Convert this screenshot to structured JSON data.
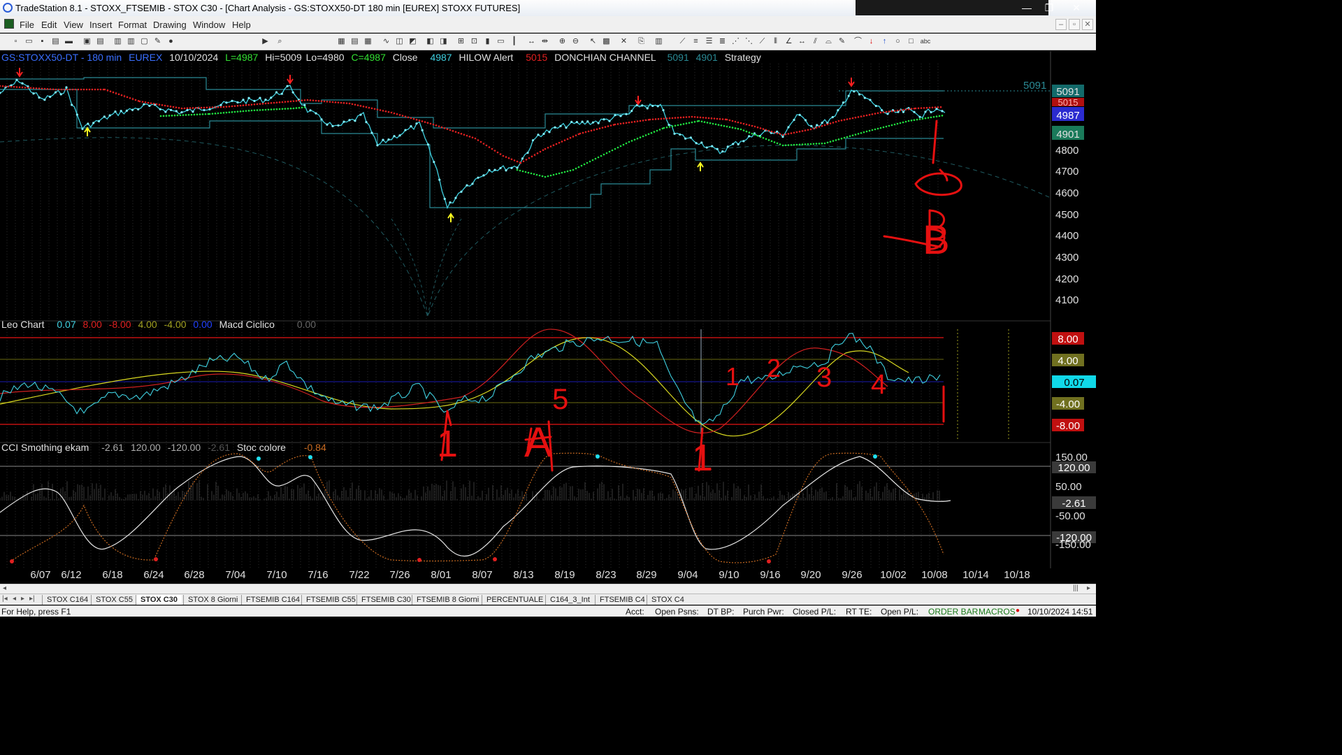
{
  "window": {
    "title": "TradeStation 8.1 - STOXX_FTSEMIB - STOX  C30 - [Chart Analysis - GS:STOXX50-DT  180 min  [EUREX] STOXX FUTURES]",
    "minimize": "—",
    "restore": "❐",
    "close": "✕"
  },
  "menu": {
    "items": [
      "File",
      "Edit",
      "View",
      "Insert",
      "Format",
      "Drawing",
      "Window",
      "Help"
    ],
    "mdi": [
      "–",
      "▫",
      "✕"
    ]
  },
  "toolbar": {
    "symbol_value": "r",
    "text_tool": "abc"
  },
  "price_panel": {
    "symbol": "GS:STOXX50-DT - 180 min",
    "exchange": "EUREX",
    "date": "10/10/2024",
    "last": "L=4987",
    "hi": "Hi=5009",
    "lo": "Lo=4980",
    "close_val": "C=4987",
    "close_lbl": "Close",
    "close_num": "4987",
    "hilow": "HILOW Alert",
    "hilow_num": "5015",
    "donchian": "DONCHIAN CHANNEL",
    "don_hi": "5091",
    "don_lo": "4901",
    "strategy": "Strategy",
    "level_5091_text": "5091",
    "axis_ticks": [
      "4800",
      "4700",
      "4600",
      "4500",
      "4400",
      "4300",
      "4200",
      "4100"
    ],
    "boxes": {
      "b5091": "5091",
      "b5015": "5015",
      "b4987": "4987",
      "b4901": "4901"
    }
  },
  "leo_panel": {
    "name": "Leo Chart",
    "v1": "0.07",
    "v2": "8.00",
    "v3": "-8.00",
    "v4": "4.00",
    "v5": "-4.00",
    "v6": "0.00",
    "macd": "Macd Ciclico",
    "macd_val": "0.00",
    "boxes": {
      "p8": "8.00",
      "p4": "4.00",
      "z": "0.07",
      "m4": "-4.00",
      "m8": "-8.00"
    }
  },
  "cci_panel": {
    "name": "CCI Smothing ekam",
    "v1": "-2.61",
    "v2": "120.00",
    "v3": "-120.00",
    "v4": "-2.61",
    "stoc": "Stoc colore",
    "stoc_val": "-0.84",
    "boxes": {
      "p150": "150.00",
      "p120": "120.00",
      "p50": "50.00",
      "cur": "-2.61",
      "m50": "-50.00",
      "m120": "-120.00",
      "m150": "-150.00"
    }
  },
  "date_axis": [
    "6/07",
    "6/12",
    "6/18",
    "6/24",
    "6/28",
    "7/04",
    "7/10",
    "7/16",
    "7/22",
    "7/26",
    "8/01",
    "8/07",
    "8/13",
    "8/19",
    "8/23",
    "8/29",
    "9/04",
    "9/10",
    "9/16",
    "9/20",
    "9/26",
    "10/02",
    "10/08",
    "10/14",
    "10/18"
  ],
  "tabs": [
    "STOX C164",
    "STOX C55",
    "STOX  C30",
    "STOX  8 Giorni",
    "FTSEMIB C164",
    "FTSEMIB C55",
    "FTSEMIB C30",
    "FTSEMIB  8 Giorni",
    "PERCENTUALE",
    "C164_3_Int",
    "FTSEMIB C4",
    "STOX  C4"
  ],
  "active_tab": 2,
  "statusbar": {
    "help": "For Help, press F1",
    "acct": "Acct:",
    "open_psns": "Open Psns:",
    "dt_bp": "DT BP:",
    "purch_pwr": "Purch Pwr:",
    "closed_pl": "Closed P/L:",
    "rt_te": "RT TE:",
    "open_pl": "Open P/L:",
    "order_bar": "ORDER BAR",
    "macros": "MACROS",
    "datetime": "10/10/2024 14:51"
  },
  "annotations": {
    "a_letter": "A",
    "b_letter": "B",
    "five": "5",
    "one_a": "1",
    "one_b": "1",
    "n1": "1",
    "n2": "2",
    "n3": "3",
    "n4": "4"
  },
  "colors": {
    "price": "#3fd0e0",
    "red_avg": "#e02020",
    "green_avg": "#20e040",
    "channel": "#2a8a95",
    "yellow": "#d8d820",
    "markup": "#e51010"
  }
}
